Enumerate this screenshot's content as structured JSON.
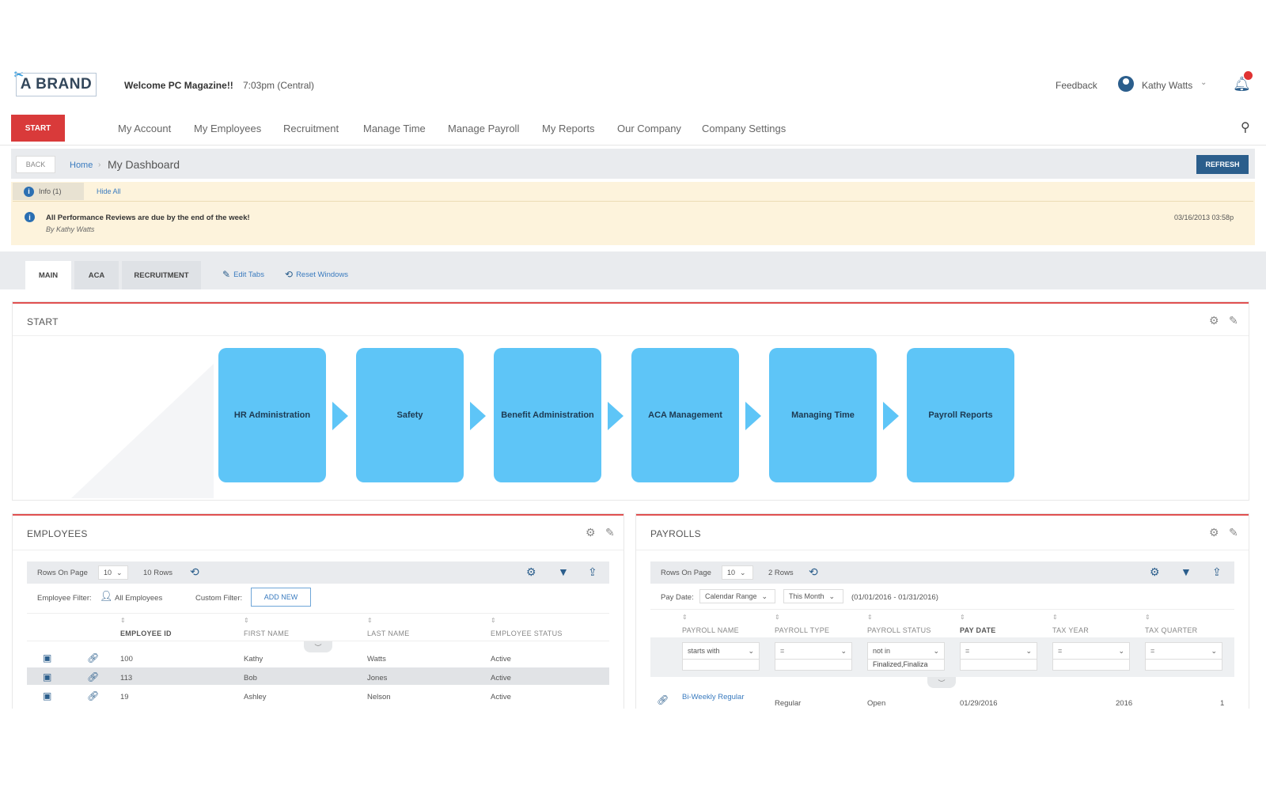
{
  "header": {
    "logo_text": "A BRAND",
    "welcome": "Welcome PC Magazine!!",
    "time": "7:03pm (Central)",
    "feedback": "Feedback",
    "user_name": "Kathy Watts"
  },
  "nav": {
    "start_label": "START",
    "items": [
      "My Account",
      "My Employees",
      "Recruitment",
      "Manage Time",
      "Manage Payroll",
      "My Reports",
      "Our Company",
      "Company Settings"
    ]
  },
  "breadcrumb": {
    "back": "BACK",
    "home": "Home",
    "current": "My Dashboard",
    "refresh": "REFRESH"
  },
  "info": {
    "tab_label": "Info (1)",
    "hide_all": "Hide All",
    "message": "All Performance Reviews are due by the end of the week!",
    "by": "By Kathy Watts",
    "date": "03/16/2013 03:58p"
  },
  "dashboard_tabs": {
    "tabs": [
      "MAIN",
      "ACA",
      "RECRUITMENT"
    ],
    "edit_tabs": "Edit Tabs",
    "reset_windows": "Reset Windows"
  },
  "start_panel": {
    "title": "START",
    "steps": [
      "HR Administration",
      "Safety",
      "Benefit Administration",
      "ACA Management",
      "Managing Time",
      "Payroll Reports"
    ]
  },
  "employees": {
    "title": "EMPLOYEES",
    "rows_on_page_label": "Rows On Page",
    "rows_on_page": "10",
    "row_count": "10 Rows",
    "employee_filter_label": "Employee Filter:",
    "employee_filter_value": "All Employees",
    "custom_filter_label": "Custom Filter:",
    "add_new": "ADD NEW",
    "columns": [
      "EMPLOYEE ID",
      "FIRST NAME",
      "LAST NAME",
      "EMPLOYEE STATUS"
    ],
    "rows": [
      {
        "id": "100",
        "first": "Kathy",
        "last": "Watts",
        "status": "Active"
      },
      {
        "id": "113",
        "first": "Bob",
        "last": "Jones",
        "status": "Active"
      },
      {
        "id": "19",
        "first": "Ashley",
        "last": "Nelson",
        "status": "Active"
      }
    ]
  },
  "payrolls": {
    "title": "PAYROLLS",
    "rows_on_page_label": "Rows On Page",
    "rows_on_page": "10",
    "row_count": "2 Rows",
    "pay_date_label": "Pay Date:",
    "range_type": "Calendar Range",
    "range_value": "This Month",
    "range_dates": "(01/01/2016 - 01/31/2016)",
    "columns": [
      "PAYROLL NAME",
      "PAYROLL TYPE",
      "PAYROLL STATUS",
      "PAY DATE",
      "TAX YEAR",
      "TAX QUARTER"
    ],
    "filters": {
      "name_op": "starts with",
      "type_op": "=",
      "status_op": "not in",
      "status_value": "Finalized,Finaliza",
      "date_op": "=",
      "year_op": "=",
      "quarter_op": "="
    },
    "rows": [
      {
        "name": "Bi-Weekly Regular",
        "type": "Regular",
        "status": "Open",
        "date": "01/29/2016",
        "year": "2016",
        "quarter": "1"
      }
    ]
  },
  "colors": {
    "brand_red": "#d93a3a",
    "brand_blue": "#2b5e8c",
    "step_blue": "#5ec5f7",
    "info_bg": "#fdf3dc"
  }
}
